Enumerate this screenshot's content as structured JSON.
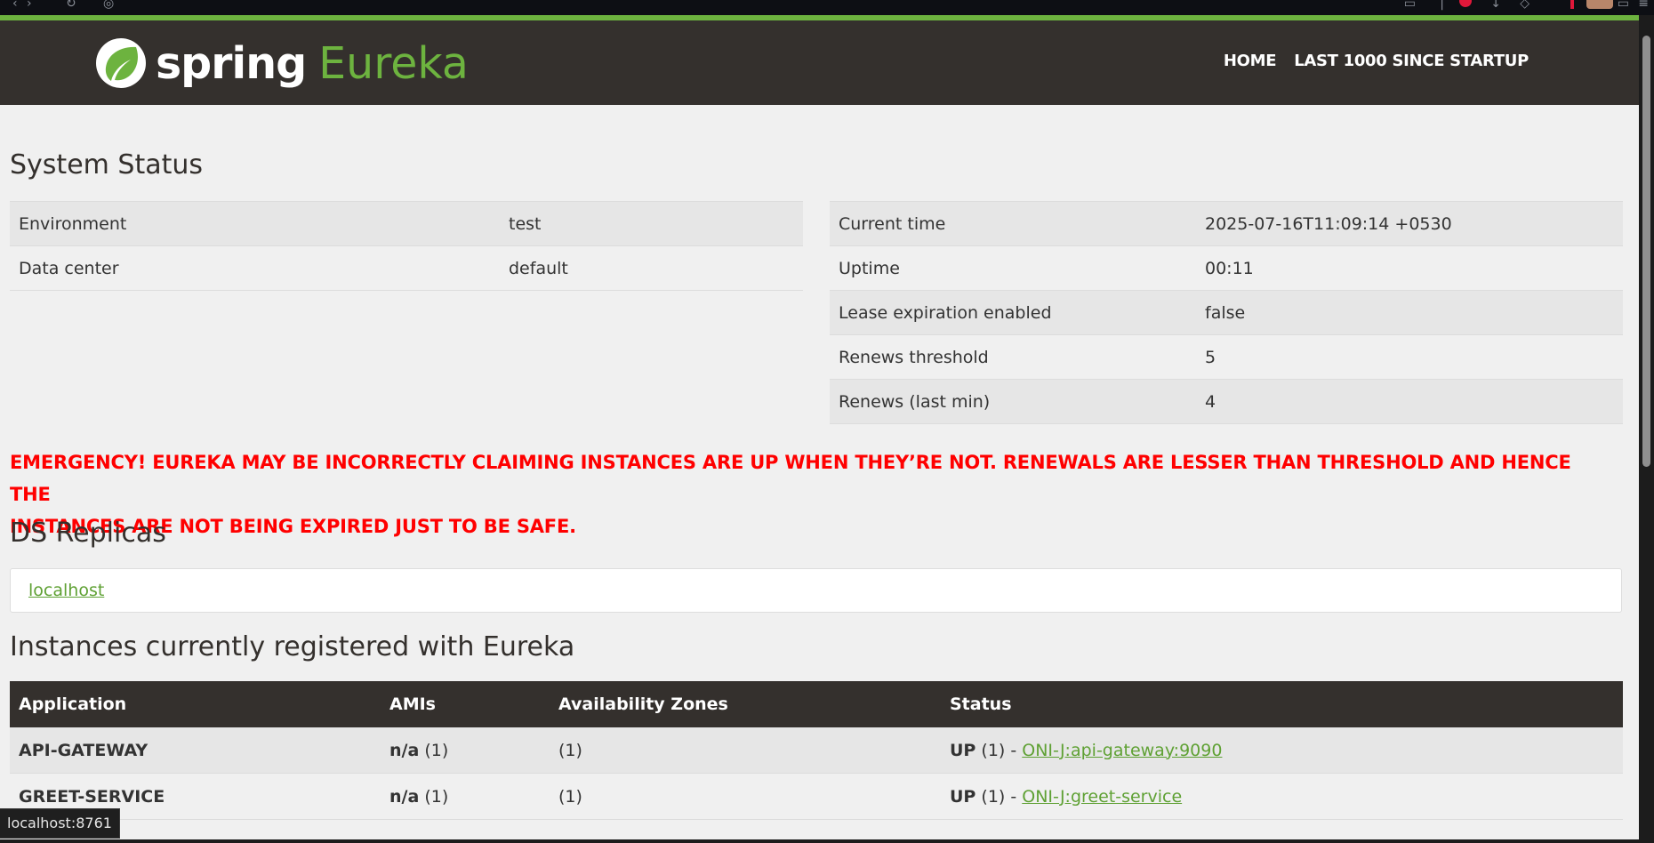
{
  "colors": {
    "brand_green": "#6db33f",
    "navbar_bg": "#34302d",
    "emergency_red": "#ff0000",
    "link_green": "#5fa134"
  },
  "navbar": {
    "logo_icon": "spring-leaf-icon",
    "brand_spring": "spring",
    "brand_eureka": "Eureka",
    "links": [
      "HOME",
      "LAST 1000 SINCE STARTUP"
    ]
  },
  "system_status": {
    "heading": "System Status",
    "left": [
      {
        "label": "Environment",
        "value": "test"
      },
      {
        "label": "Data center",
        "value": "default"
      }
    ],
    "right": [
      {
        "label": "Current time",
        "value": "2025-07-16T11:09:14 +0530"
      },
      {
        "label": "Uptime",
        "value": "00:11"
      },
      {
        "label": "Lease expiration enabled",
        "value": "false"
      },
      {
        "label": "Renews threshold",
        "value": "5"
      },
      {
        "label": "Renews (last min)",
        "value": "4"
      }
    ]
  },
  "emergency": {
    "line1": "EMERGENCY! EUREKA MAY BE INCORRECTLY CLAIMING INSTANCES ARE UP WHEN THEY’RE NOT. RENEWALS ARE LESSER THAN THRESHOLD AND HENCE THE",
    "line2": "INSTANCES ARE NOT BEING EXPIRED JUST TO BE SAFE."
  },
  "replicas": {
    "heading": "DS Replicas",
    "link": "localhost"
  },
  "instances": {
    "heading": "Instances currently registered with Eureka",
    "columns": [
      "Application",
      "AMIs",
      "Availability Zones",
      "Status"
    ],
    "rows": [
      {
        "application": "API-GATEWAY",
        "ami_bold": "n/a",
        "ami_count": "(1)",
        "zones": "(1)",
        "status_bold": "UP",
        "status_count": "(1) -",
        "link": "ONI-J:api-gateway:9090"
      },
      {
        "application": "GREET-SERVICE",
        "ami_bold": "n/a",
        "ami_count": "(1)",
        "zones": "(1)",
        "status_bold": "UP",
        "status_count": "(1) -",
        "link": "ONI-J:greet-service"
      }
    ]
  },
  "status_bar": {
    "url": "localhost:8761"
  }
}
